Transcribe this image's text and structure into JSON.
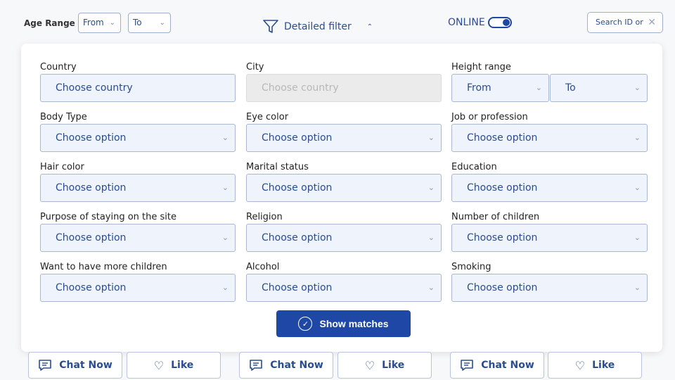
{
  "top": {
    "age_label": "Age Range",
    "age_from": "From",
    "age_to": "To",
    "detailed_filter": "Detailed filter",
    "online_label": "ONLINE",
    "search_id": "Search ID or"
  },
  "filters": {
    "country": {
      "label": "Country",
      "value": "Choose country"
    },
    "city": {
      "label": "City",
      "value": "Choose country"
    },
    "height": {
      "label": "Height range",
      "from": "From",
      "to": "To"
    },
    "body_type": {
      "label": "Body Type",
      "value": "Choose option"
    },
    "eye_color": {
      "label": "Eye color",
      "value": "Choose option"
    },
    "job": {
      "label": "Job or profession",
      "value": "Choose option"
    },
    "hair_color": {
      "label": "Hair color",
      "value": "Choose option"
    },
    "marital": {
      "label": "Marital status",
      "value": "Choose option"
    },
    "education": {
      "label": "Education",
      "value": "Choose option"
    },
    "purpose": {
      "label": "Purpose of staying on the site",
      "value": "Choose option"
    },
    "religion": {
      "label": "Religion",
      "value": "Choose option"
    },
    "children": {
      "label": "Number of children",
      "value": "Choose option"
    },
    "more_children": {
      "label": "Want to have more children",
      "value": "Choose option"
    },
    "alcohol": {
      "label": "Alcohol",
      "value": "Choose option"
    },
    "smoking": {
      "label": "Smoking",
      "value": "Choose option"
    }
  },
  "show_matches": "Show matches",
  "cards": {
    "chat": "Chat Now",
    "like": "Like"
  }
}
